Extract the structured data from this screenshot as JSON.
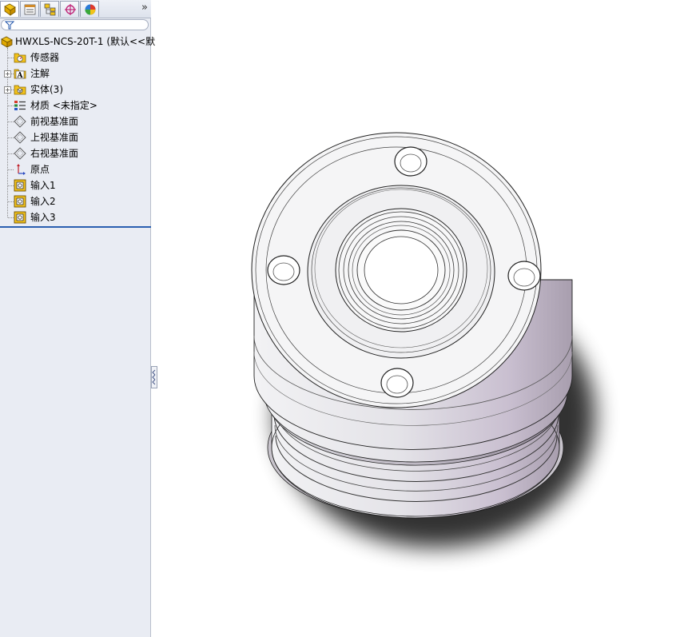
{
  "feature_tree": {
    "root_label": "HWXLS-NCS-20T-1 (默认<<默",
    "items": [
      {
        "label": "传感器",
        "icon": "sensor-folder-icon"
      },
      {
        "label": "注解",
        "icon": "annotation-icon"
      },
      {
        "label": "实体(3)",
        "icon": "solid-bodies-folder-icon"
      },
      {
        "label": "材质 <未指定>",
        "icon": "material-icon"
      },
      {
        "label": "前视基准面",
        "icon": "plane-icon"
      },
      {
        "label": "上视基准面",
        "icon": "plane-icon"
      },
      {
        "label": "右视基准面",
        "icon": "plane-icon"
      },
      {
        "label": "原点",
        "icon": "origin-icon"
      },
      {
        "label": "输入1",
        "icon": "imported-body-icon"
      },
      {
        "label": "输入2",
        "icon": "imported-body-icon"
      },
      {
        "label": "输入3",
        "icon": "imported-body-icon"
      }
    ]
  },
  "tabs": [
    {
      "name": "feature-manager-tab",
      "icon": "feature-manager-icon"
    },
    {
      "name": "property-manager-tab",
      "icon": "property-manager-icon"
    },
    {
      "name": "configuration-manager-tab",
      "icon": "configuration-manager-icon"
    },
    {
      "name": "dimxpert-tab",
      "icon": "dimxpert-icon"
    },
    {
      "name": "display-manager-tab",
      "icon": "display-manager-icon"
    }
  ],
  "more_tabs_label": "»",
  "colors": {
    "panel_bg": "#e9ecf3",
    "rollback_bar": "#2a5fb0",
    "folder_yellow": "#f3c21a"
  }
}
